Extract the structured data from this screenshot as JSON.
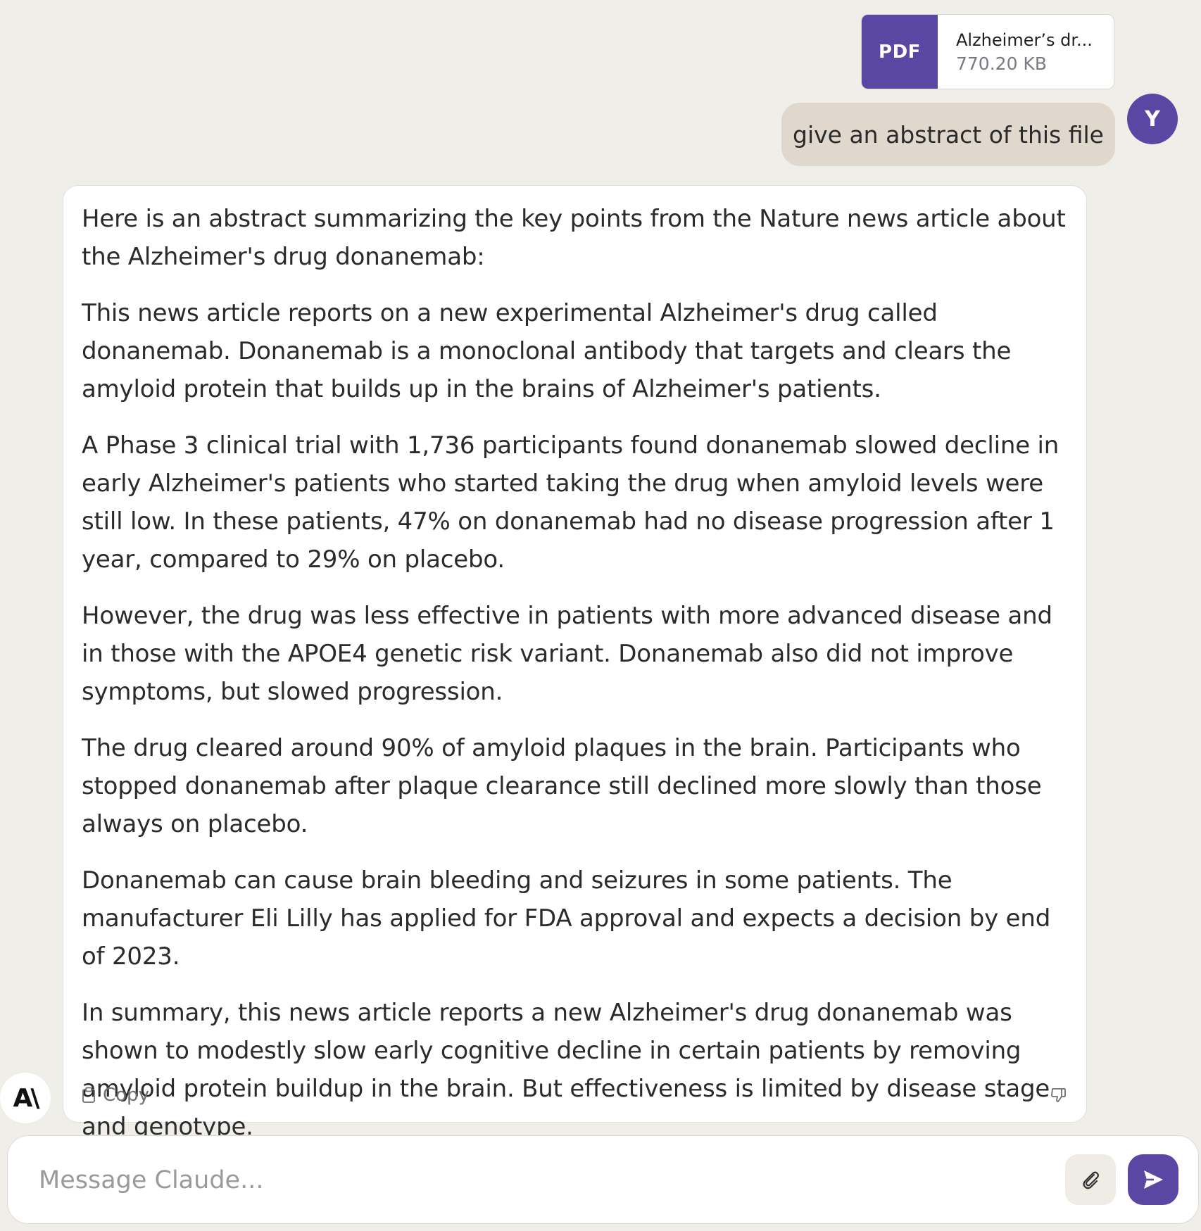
{
  "attachment": {
    "type_label": "PDF",
    "filename": "Alzheimer’s dr...",
    "size": "770.20 KB"
  },
  "user_message": {
    "text": "give an abstract of this file",
    "avatar_initial": "Y"
  },
  "assistant_message": {
    "paragraphs": [
      "Here is an abstract summarizing the key points from the Nature news article about the Alzheimer's drug donanemab:",
      "This news article reports on a new experimental Alzheimer's drug called donanemab. Donanemab is a monoclonal antibody that targets and clears the amyloid protein that builds up in the brains of Alzheimer's patients.",
      "A Phase 3 clinical trial with 1,736 participants found donanemab slowed decline in early Alzheimer's patients who started taking the drug when amyloid levels were still low. In these patients, 47% on donanemab had no disease progression after 1 year, compared to 29% on placebo.",
      "However, the drug was less effective in patients with more advanced disease and in those with the APOE4 genetic risk variant. Donanemab also did not improve symptoms, but slowed progression.",
      "The drug cleared around 90% of amyloid plaques in the brain. Participants who stopped donanemab after plaque clearance still declined more slowly than those always on placebo.",
      "Donanemab can cause brain bleeding and seizures in some patients. The manufacturer Eli Lilly has applied for FDA approval and expects a decision by end of 2023.",
      "In summary, this news article reports a new Alzheimer's drug donanemab was shown to modestly slow early cognitive decline in certain patients by removing amyloid protein buildup in the brain. But effectiveness is limited by disease stage and genotype."
    ],
    "copy_label": "Copy",
    "logo_text": "A\\"
  },
  "composer": {
    "placeholder": "Message Claude..."
  },
  "colors": {
    "accent": "#5a46a3",
    "background": "#f0eee9",
    "user_bubble": "#e0d8cc"
  },
  "icons": {
    "copy": "clipboard-icon",
    "feedback": "thumbs-down-icon",
    "attach": "paperclip-icon",
    "send": "send-arrow-icon"
  }
}
